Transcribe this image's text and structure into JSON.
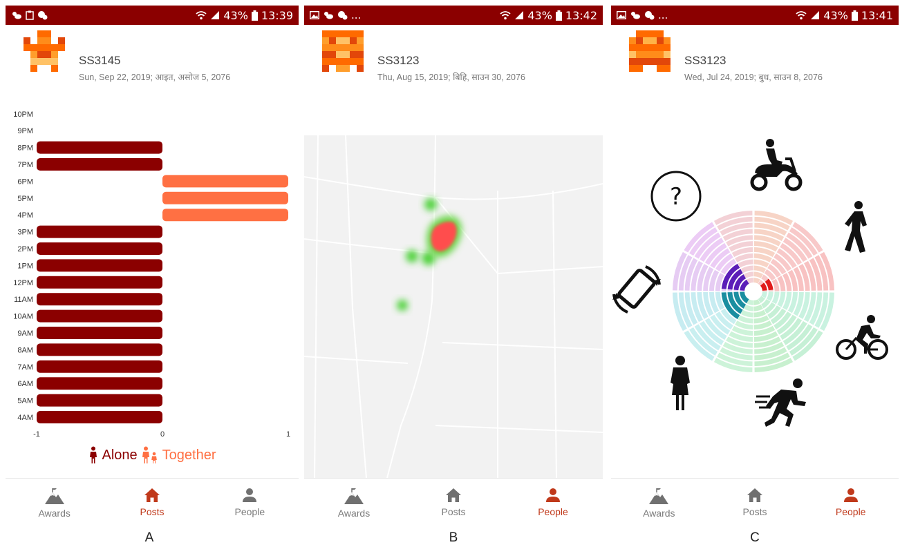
{
  "status_bars": [
    {
      "left_extra": "",
      "battery": "43%",
      "time": "13:39"
    },
    {
      "left_extra": "...",
      "battery": "43%",
      "time": "13:42"
    },
    {
      "left_extra": "...",
      "battery": "43%",
      "time": "13:41"
    }
  ],
  "panels": [
    {
      "user_id": "SS3145",
      "date": "Sun, Sep 22, 2019;  आइत, असोज 5, 2076",
      "caption": "A"
    },
    {
      "user_id": "SS3123",
      "date": "Thu, Aug 15, 2019;  बिहि, साउन 30, 2076",
      "caption": "B"
    },
    {
      "user_id": "SS3123",
      "date": "Wed, Jul 24, 2019;  बुध, साउन 8, 2076",
      "caption": "C"
    }
  ],
  "tabs": [
    {
      "awards": "Awards",
      "posts": "Posts",
      "people": "People",
      "active": "posts"
    },
    {
      "awards": "Awards",
      "posts": "Posts",
      "people": "People",
      "active": "people"
    },
    {
      "awards": "Awards",
      "posts": "Posts",
      "people": "People",
      "active": "people"
    }
  ],
  "colors": {
    "status_bar": "#8b0000",
    "alone": "#8b0000",
    "together": "#ff7043",
    "active_tab": "#c0391b"
  },
  "legend": {
    "alone": "Alone",
    "together": "Together"
  },
  "chart_data": {
    "type": "bar",
    "orientation": "horizontal",
    "categories": [
      "4AM",
      "5AM",
      "6AM",
      "7AM",
      "8AM",
      "9AM",
      "10AM",
      "11AM",
      "12PM",
      "1PM",
      "2PM",
      "3PM",
      "4PM",
      "5PM",
      "6PM",
      "7PM",
      "8PM",
      "9PM",
      "10PM"
    ],
    "values": [
      -1,
      -1,
      -1,
      -1,
      -1,
      -1,
      -1,
      -1,
      -1,
      -1,
      -1,
      -1,
      1,
      1,
      1,
      -1,
      -1,
      0,
      0
    ],
    "series": [
      {
        "name": "Alone",
        "value": -1
      },
      {
        "name": "Together",
        "value": 1
      }
    ],
    "xticks": [
      "-1",
      "0",
      "1"
    ],
    "xlim": [
      -1,
      1
    ]
  }
}
